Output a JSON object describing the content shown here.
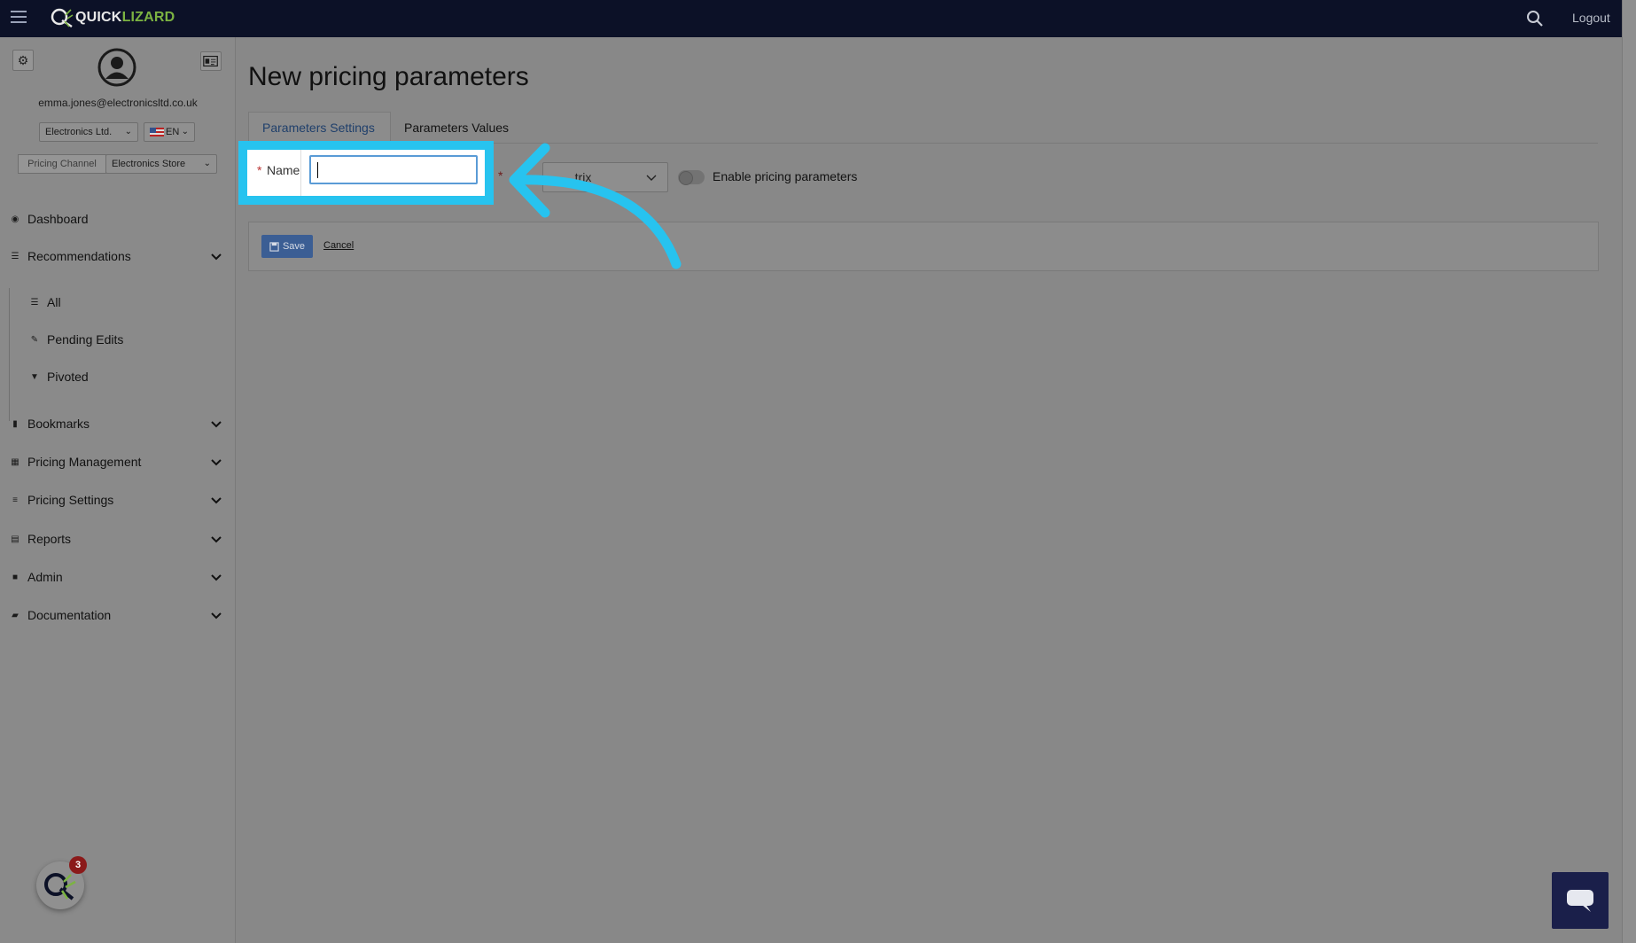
{
  "app": {
    "brand_part1": "QUICK",
    "brand_part2": "LIZARD",
    "logout_label": "Logout"
  },
  "user": {
    "email": "emma.jones@electronicsltd.co.uk",
    "company": "Electronics Ltd.",
    "language": "EN",
    "pricing_channel_label": "Pricing Channel",
    "pricing_channel": "Electronics Store"
  },
  "sidebar": {
    "items": [
      {
        "label": "Dashboard",
        "icon": "dashboard-icon"
      },
      {
        "label": "Recommendations",
        "icon": "list-icon"
      },
      {
        "label": "All",
        "icon": "list-icon"
      },
      {
        "label": "Pending Edits",
        "icon": "edit-icon"
      },
      {
        "label": "Pivoted",
        "icon": "filter-icon"
      },
      {
        "label": "Bookmarks",
        "icon": "bookmark-icon"
      },
      {
        "label": "Pricing Management",
        "icon": "calendar-icon"
      },
      {
        "label": "Pricing Settings",
        "icon": "sliders-icon"
      },
      {
        "label": "Reports",
        "icon": "report-icon"
      },
      {
        "label": "Admin",
        "icon": "lock-icon"
      },
      {
        "label": "Documentation",
        "icon": "book-icon"
      }
    ],
    "notification_count": "3"
  },
  "main": {
    "title": "New pricing parameters",
    "tabs": [
      {
        "label": "Parameters Settings",
        "active": true
      },
      {
        "label": "Parameters Values",
        "active": false
      }
    ],
    "form": {
      "name_label": "Name",
      "name_value": "",
      "required_marker": "*",
      "type_partial_value": "...trix",
      "toggle_label": "Enable pricing parameters",
      "toggle_on": false
    },
    "actions": {
      "save_label": "Save",
      "cancel_label": "Cancel"
    }
  },
  "colors": {
    "topbar": "#0c1127",
    "highlight": "#27c3ef",
    "save_button": "#3b5e94",
    "brand_green": "#7cb342"
  }
}
